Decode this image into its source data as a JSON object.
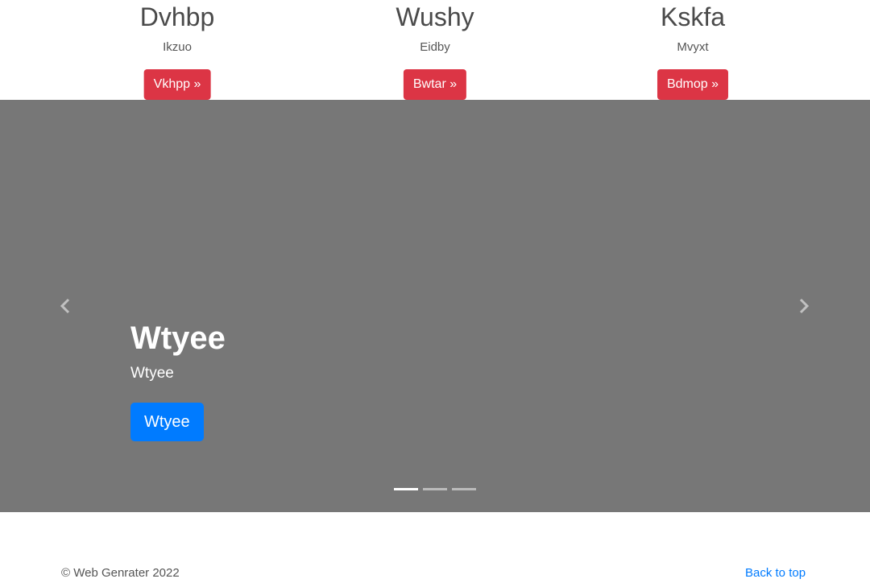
{
  "features": [
    {
      "title": "Dvhbp",
      "subtitle": "Ikzuo",
      "button": "Vkhpp »"
    },
    {
      "title": "Wushy",
      "subtitle": "Eidby",
      "button": "Bwtar »"
    },
    {
      "title": "Kskfa",
      "subtitle": "Mvyxt",
      "button": "Bdmop »"
    }
  ],
  "carousel": {
    "title": "Wtyee",
    "subtitle": "Wtyee",
    "button": "Wtyee",
    "active_slide": 1,
    "slide_count": 3
  },
  "footer": {
    "copyright": "© Web Genrater 2022",
    "back_to_top": "Back to top"
  },
  "colors": {
    "danger": "#dc3545",
    "primary": "#007bff",
    "carousel_bg": "#777777"
  }
}
